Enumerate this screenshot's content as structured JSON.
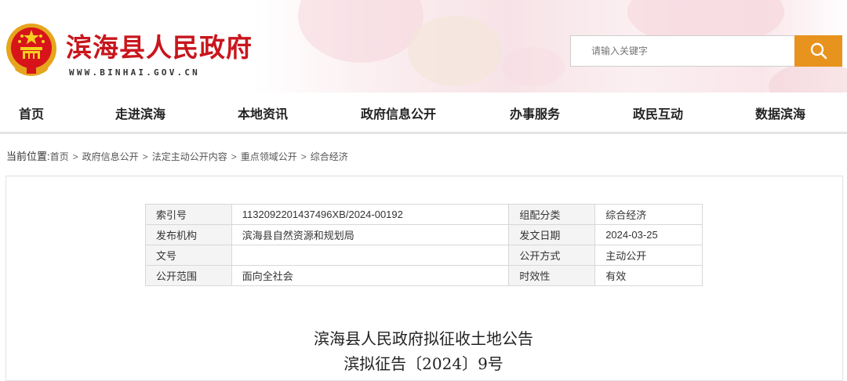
{
  "header": {
    "site_title": "滨海县人民政府",
    "site_url": "WWW.BINHAI.GOV.CN",
    "search_placeholder": "请输入关键字"
  },
  "nav": [
    "首页",
    "走进滨海",
    "本地资讯",
    "政府信息公开",
    "办事服务",
    "政民互动",
    "数据滨海"
  ],
  "breadcrumb": {
    "lead": "当前位置:",
    "items": [
      "首页",
      "政府信息公开",
      "法定主动公开内容",
      "重点领域公开",
      "综合经济"
    ]
  },
  "meta_table": [
    [
      "索引号",
      "1132092201437496XB/2024-00192",
      "组配分类",
      "综合经济"
    ],
    [
      "发布机构",
      "滨海县自然资源和规划局",
      "发文日期",
      "2024-03-25"
    ],
    [
      "文号",
      "",
      "公开方式",
      "主动公开"
    ],
    [
      "公开范围",
      "面向全社会",
      "时效性",
      "有效"
    ]
  ],
  "document": {
    "title": "滨海县人民政府拟征收土地公告",
    "number": "滨拟征告〔2024〕9号"
  },
  "colors": {
    "brand_red": "#c8161d",
    "search_orange": "#e7931d"
  },
  "icons": {
    "emblem": "national-emblem-icon",
    "search": "search-icon"
  }
}
